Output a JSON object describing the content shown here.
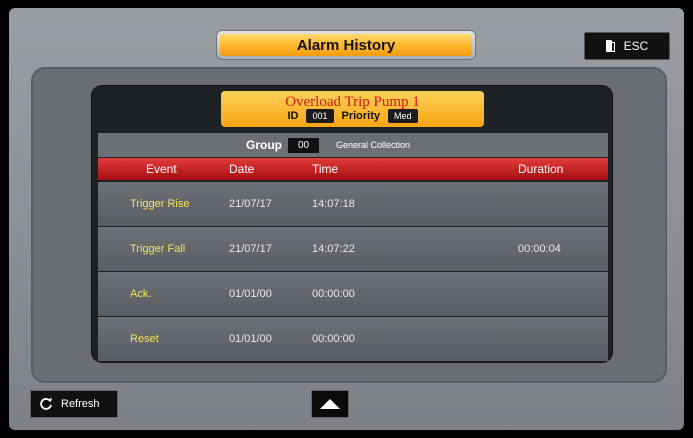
{
  "title": "Alarm History",
  "esc_label": "ESC",
  "alarm": {
    "name": "Overload Trip Pump 1",
    "id_label": "ID",
    "id_value": "001",
    "priority_label": "Priority",
    "priority_value": "Med"
  },
  "group": {
    "label": "Group",
    "value": "00",
    "name": "General Collection"
  },
  "columns": {
    "event": "Event",
    "date": "Date",
    "time": "Time",
    "duration": "Duration"
  },
  "rows": [
    {
      "event": "Trigger Rise",
      "date": "21/07/17",
      "time": "14:07:18",
      "duration": ""
    },
    {
      "event": "Trigger Fall",
      "date": "21/07/17",
      "time": "14:07:22",
      "duration": "00:00:04"
    },
    {
      "event": "Ack.",
      "date": "01/01/00",
      "time": "00:00:00",
      "duration": ""
    },
    {
      "event": "Reset",
      "date": "01/01/00",
      "time": "00:00:00",
      "duration": ""
    }
  ],
  "refresh_label": "Refresh",
  "icons": {
    "esc": "door-icon",
    "refresh": "refresh-icon",
    "scroll_up": "arrow-up-icon"
  },
  "colors": {
    "title_accent": "#ffb52a",
    "header_red": "#c41e1e",
    "event_text": "#f1e65a",
    "alarm_name": "#d01818"
  }
}
